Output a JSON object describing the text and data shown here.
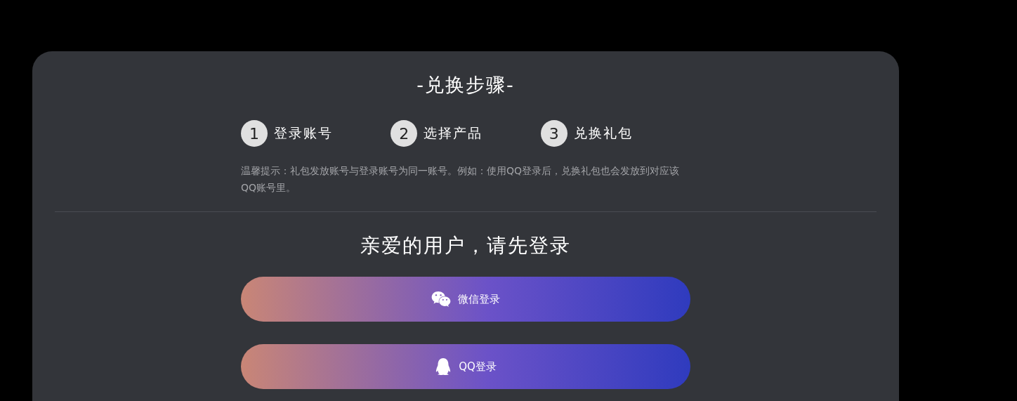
{
  "steps_title": "-兑换步骤-",
  "steps": [
    {
      "number": "1",
      "label": "登录账号"
    },
    {
      "number": "2",
      "label": "选择产品"
    },
    {
      "number": "3",
      "label": "兑换礼包"
    }
  ],
  "hint": "温馨提示：礼包发放账号与登录账号为同一账号。例如：使用QQ登录后，兑换礼包也会发放到对应该QQ账号里。",
  "login_title": "亲爱的用户，请先登录",
  "login_buttons": [
    {
      "kind": "wechat",
      "label": "微信登录"
    },
    {
      "kind": "qq",
      "label": "QQ登录"
    }
  ]
}
